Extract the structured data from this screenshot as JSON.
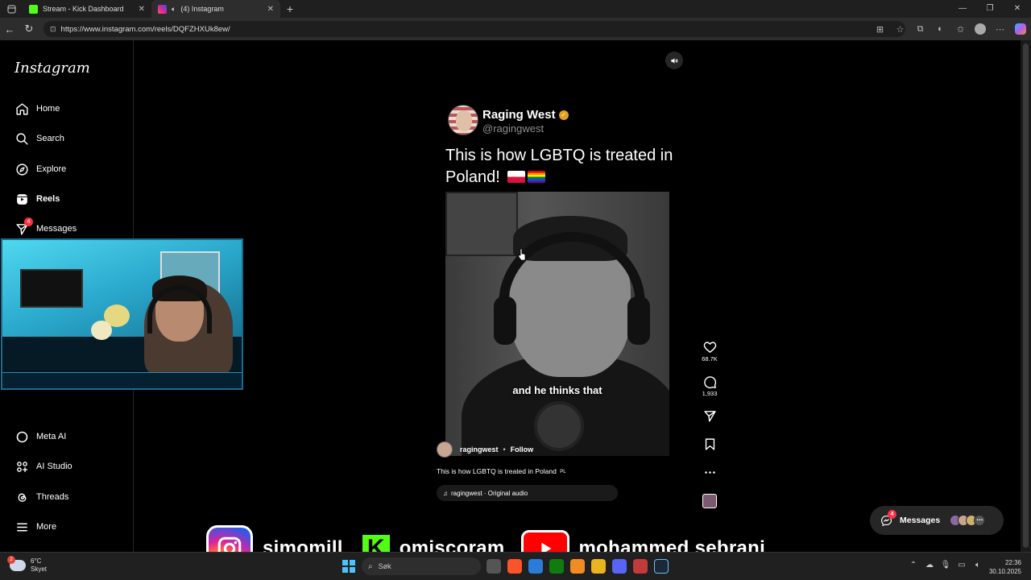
{
  "browser": {
    "tabs": [
      {
        "title": "Stream - Kick Dashboard"
      },
      {
        "title": "(4) Instagram"
      }
    ],
    "url": "https://www.instagram.com/reels/DQFZHXUk8ew/"
  },
  "sidebar": {
    "logo": "Instagram",
    "nav": [
      {
        "label": "Home",
        "icon": "home-icon"
      },
      {
        "label": "Search",
        "icon": "search-icon"
      },
      {
        "label": "Explore",
        "icon": "compass-icon"
      },
      {
        "label": "Reels",
        "icon": "reels-icon"
      },
      {
        "label": "Messages",
        "icon": "send-icon",
        "badge": "4"
      }
    ],
    "bottom_nav": [
      {
        "label": "Meta AI",
        "icon": "meta-ai-icon"
      },
      {
        "label": "AI Studio",
        "icon": "ai-studio-icon"
      },
      {
        "label": "Threads",
        "icon": "threads-icon"
      },
      {
        "label": "More",
        "icon": "menu-icon"
      }
    ]
  },
  "reel": {
    "author_name": "Raging West",
    "author_handle": "@ragingwest",
    "post_text": "This is how LGBTQ is treated in Poland!",
    "subtitle": "and he thinks that",
    "username": "ragingwest",
    "separator": "•",
    "follow": "Follow",
    "caption": "This is how LGBTQ is treated in Poland",
    "caption_flag": "PL",
    "audio": "ragingwest · Original audio",
    "likes": "68.7K",
    "comments": "1,933"
  },
  "messages_pill": {
    "label": "Messages",
    "badge": "4"
  },
  "overlay": {
    "instagram_name": "simomill",
    "kick_letter": "K",
    "kick_name": "omiscoram",
    "youtube_name": "mohammed sebrani"
  },
  "taskbar": {
    "temperature": "6°C",
    "weather": "Skyet",
    "weather_badge": "2",
    "search_placeholder": "Søk",
    "time": "22:36",
    "date": "30.10.2025"
  },
  "colors": {
    "kick_green": "#53fc18",
    "youtube_red": "#ff0000",
    "badge_red": "#ff3040"
  }
}
